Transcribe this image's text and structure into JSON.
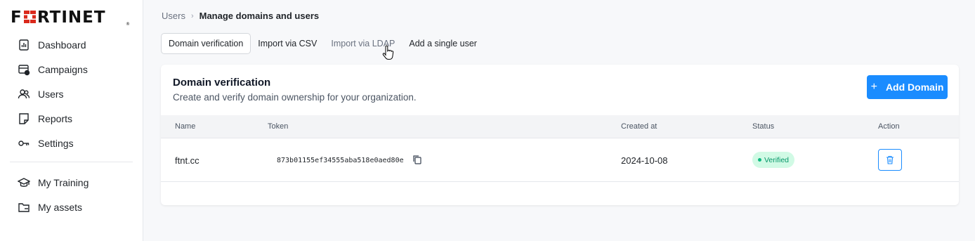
{
  "brand": {
    "logo_text": "FRTINET",
    "accent": "#1a8cff",
    "logo_red": "#da291c"
  },
  "sidebar": {
    "items": [
      {
        "label": "Dashboard",
        "icon": "dashboard-icon"
      },
      {
        "label": "Campaigns",
        "icon": "campaigns-icon"
      },
      {
        "label": "Users",
        "icon": "users-icon"
      },
      {
        "label": "Reports",
        "icon": "reports-icon"
      },
      {
        "label": "Settings",
        "icon": "settings-key-icon"
      }
    ],
    "bottom_items": [
      {
        "label": "My Training",
        "icon": "graduation-cap-icon"
      },
      {
        "label": "My assets",
        "icon": "folder-icon"
      }
    ]
  },
  "breadcrumb": {
    "parent": "Users",
    "current": "Manage domains and users"
  },
  "tabs": [
    {
      "label": "Domain verification"
    },
    {
      "label": "Import via CSV"
    },
    {
      "label": "Import via LDAP"
    },
    {
      "label": "Add a single user"
    }
  ],
  "card": {
    "title": "Domain verification",
    "subtitle": "Create and verify domain ownership for your organization.",
    "add_button": "Add Domain"
  },
  "table": {
    "headers": [
      "Name",
      "Token",
      "Created at",
      "Status",
      "Action"
    ],
    "rows": [
      {
        "name": "ftnt.cc",
        "token": "873b01155ef34555aba518e0aed80e",
        "created_at": "2024-10-08",
        "status": "Verified"
      }
    ]
  }
}
